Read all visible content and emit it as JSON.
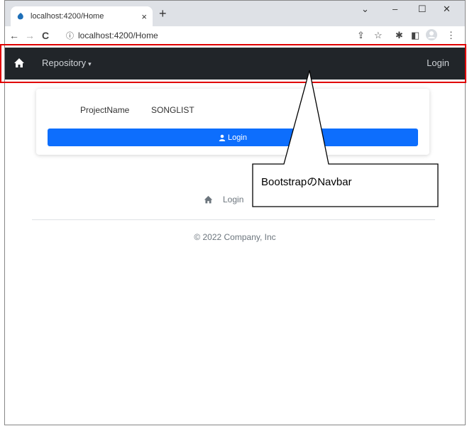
{
  "browser": {
    "tab_title": "localhost:4200/Home",
    "tab_close": "×",
    "new_tab": "+",
    "url": "localhost:4200/Home",
    "win_controls": {
      "chevron": "⌄",
      "minimize": "–",
      "maximize": "☐",
      "close": "✕"
    },
    "nav": {
      "back": "←",
      "forward": "→",
      "reload": "C",
      "info": "ⓘ"
    },
    "toolbar_icons": {
      "share": "⇪",
      "star": "☆",
      "extension": "✱",
      "sidepanel": "◧",
      "menu": "⋮"
    }
  },
  "navbar": {
    "brand_icon": "home-icon",
    "repository_label": "Repository",
    "caret": "▾",
    "login_label": "Login"
  },
  "card": {
    "project_label": "ProjectName",
    "project_value": "SONGLIST",
    "login_button_label": "Login"
  },
  "footer": {
    "login_link": "Login",
    "copyright": "© 2022 Company, Inc"
  },
  "annotation": {
    "callout_text": "BootstrapのNavbar"
  },
  "colors": {
    "navbar_bg": "#212529",
    "primary": "#0d6efd",
    "annotation_red": "#e00000"
  }
}
